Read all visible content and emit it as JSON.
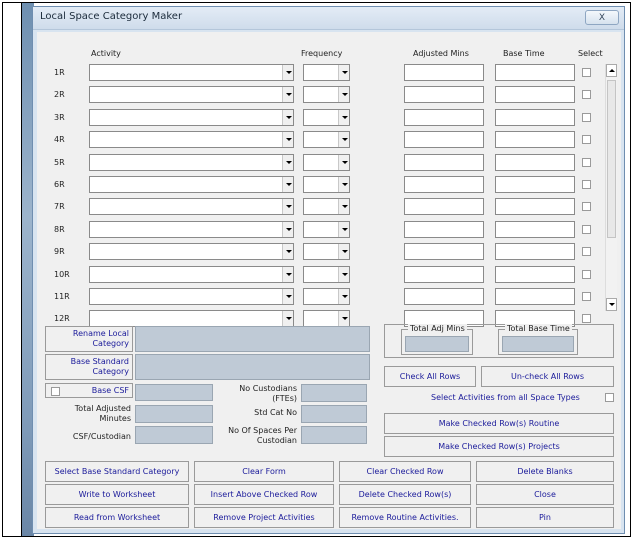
{
  "window": {
    "title": "Local Space Category Maker",
    "close_label": "X"
  },
  "headers": {
    "activity": "Activity",
    "frequency": "Frequency",
    "adjusted": "Adjusted Mins",
    "base": "Base Time",
    "select": "Select"
  },
  "rows": [
    "1R",
    "2R",
    "3R",
    "4R",
    "5R",
    "6R",
    "7R",
    "8R",
    "9R",
    "10R",
    "11R",
    "12R"
  ],
  "side": {
    "rename": "Rename Local Category",
    "base_std": "Base Standard Category",
    "base_csf": "Base CSF",
    "total_adj": "Total Adjusted Minutes",
    "csf_cust": "CSF/Custodian",
    "no_cust": "No Custodians (FTEs)",
    "std_cat": "Std Cat No",
    "no_spaces": "No Of Spaces Per Custodian"
  },
  "totals": {
    "adj": "Total Adj Mins",
    "base": "Total Base Time"
  },
  "right": {
    "check_all": "Check All Rows",
    "uncheck_all": "Un-check All Rows",
    "select_all_types": "Select Activities from all Space Types",
    "make_routine": "Make Checked Row(s) Routine",
    "make_projects": "Make Checked Row(s) Projects"
  },
  "buttons": {
    "select_base": "Select Base Standard Category",
    "clear_form": "Clear Form",
    "clear_checked": "Clear Checked Row",
    "delete_blanks": "Delete Blanks",
    "write_ws": "Write to Worksheet",
    "insert_above": "Insert Above Checked Row",
    "delete_checked": "Delete Checked Row(s)",
    "close": "Close",
    "read_ws": "Read from Worksheet",
    "remove_project": "Remove Project Activities",
    "remove_routine": "Remove Routine Activities.",
    "pin": "Pin"
  }
}
